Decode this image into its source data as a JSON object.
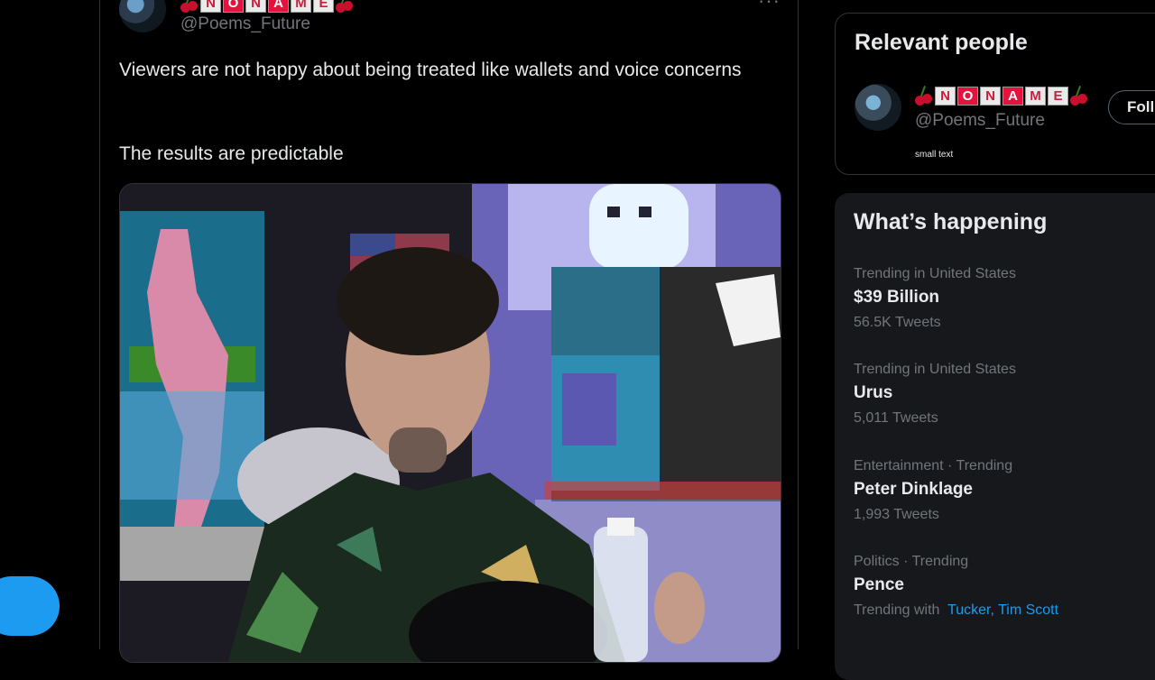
{
  "tweet": {
    "name_letters": [
      "N",
      "O",
      "N",
      "A",
      "M",
      "E"
    ],
    "handle": "@Poems_Future",
    "more": "···",
    "text_line1": "Viewers are not happy about being treated like wallets and voice concerns",
    "text_line2": "The results are predictable"
  },
  "relevant_people": {
    "title": "Relevant people",
    "user": {
      "name_letters": [
        "N",
        "O",
        "N",
        "A",
        "M",
        "E"
      ],
      "handle": "@Poems_Future",
      "bio": "small text",
      "follow_label": "Follow"
    }
  },
  "whats_happening": {
    "title": "What’s happening",
    "trends": [
      {
        "meta": "Trending in United States",
        "title": "$39 Billion",
        "count": "56.5K Tweets"
      },
      {
        "meta": "Trending in United States",
        "title": "Urus",
        "count": "5,011 Tweets"
      },
      {
        "meta": "Entertainment · Trending",
        "title": "Peter Dinklage",
        "count": "1,993 Tweets"
      },
      {
        "meta": "Politics · Trending",
        "title": "Pence",
        "with_label": "Trending with",
        "with_links": "Tucker, Tim Scott"
      }
    ]
  },
  "colors": {
    "accent": "#1d9bf0",
    "background": "#000000",
    "text": "#e7e9ea",
    "muted": "#71767b"
  },
  "icons": {
    "more": "more-dots-icon",
    "cherry": "cherry-icon"
  }
}
